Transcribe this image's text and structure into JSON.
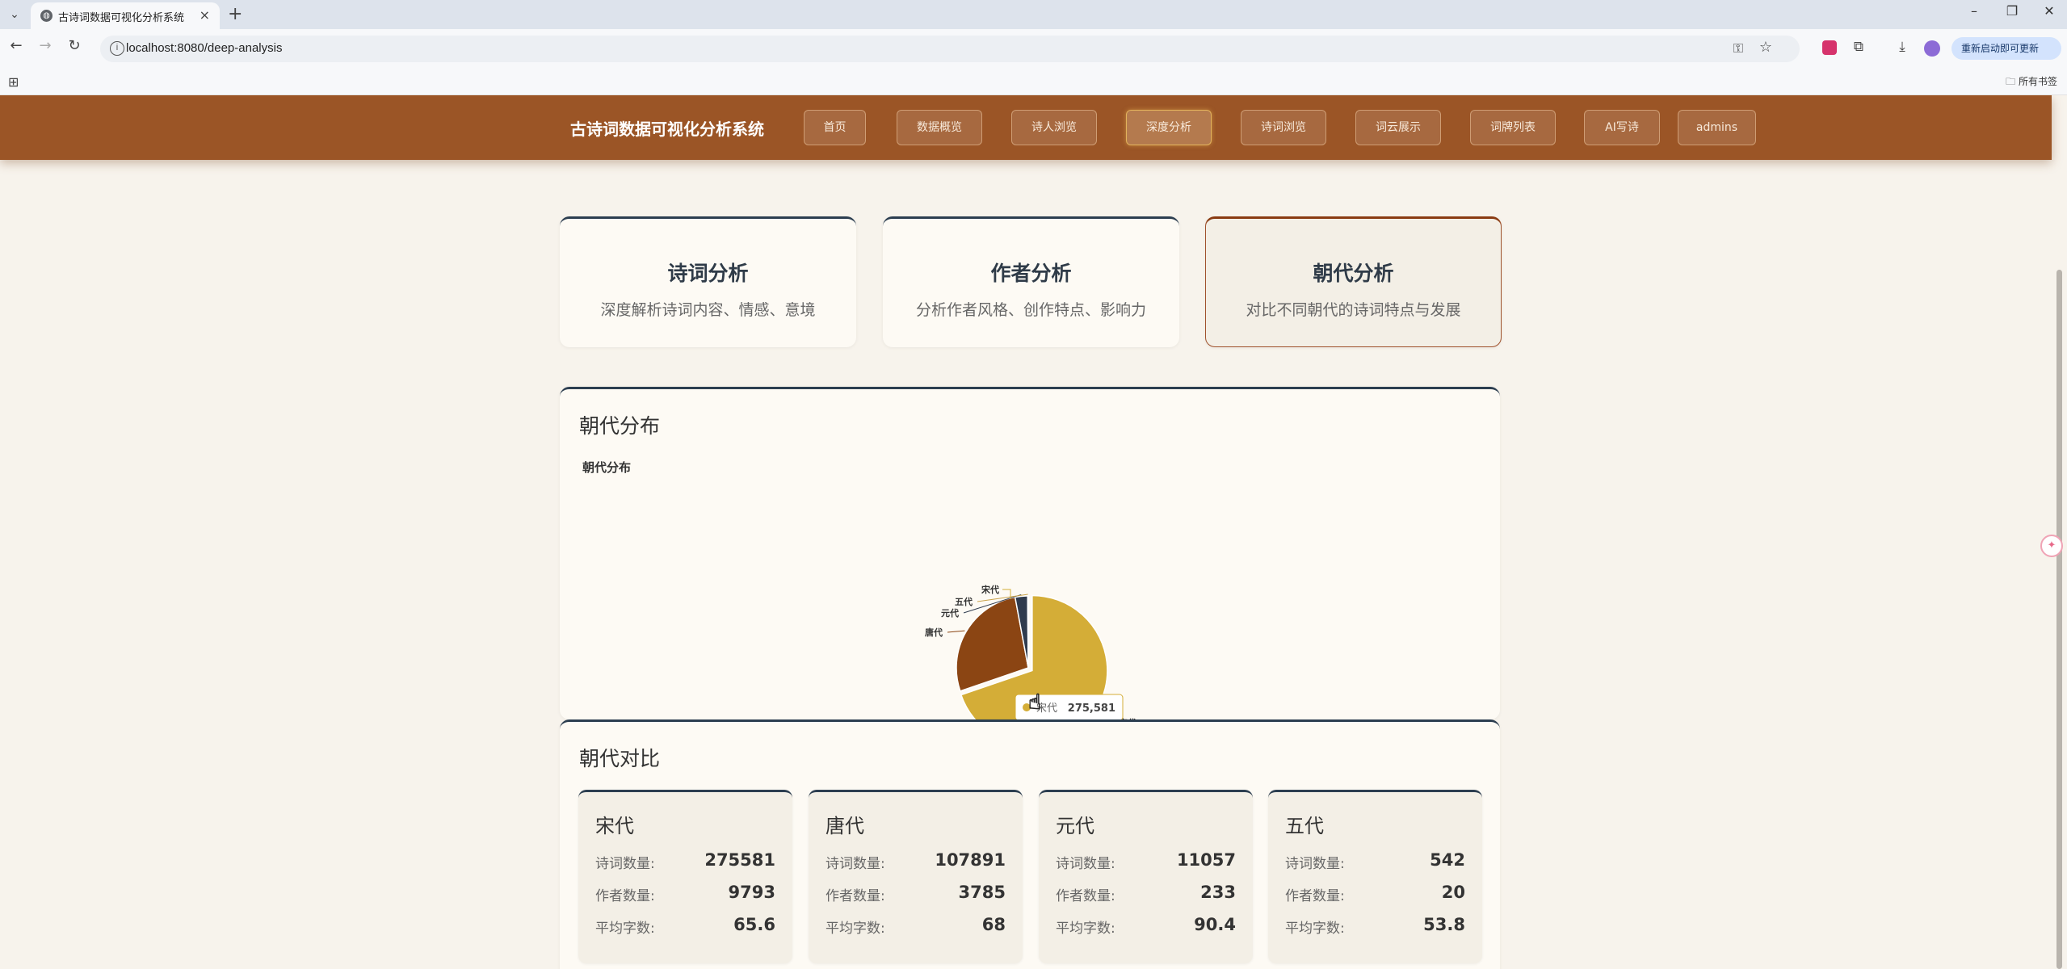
{
  "browser": {
    "tab_title": "古诗词数据可视化分析系统",
    "url": "localhost:8080/deep-analysis",
    "update_button": "重新启动即可更新",
    "bookmarks_label": "所有书签"
  },
  "header": {
    "title": "古诗词数据可视化分析系统",
    "nav": [
      "首页",
      "数据概览",
      "诗人浏览",
      "深度分析",
      "诗词浏览",
      "词云展示",
      "词牌列表",
      "AI写诗",
      "admins"
    ],
    "active_nav": "深度分析"
  },
  "features": [
    {
      "title": "诗词分析",
      "desc": "深度解析诗词内容、情感、意境"
    },
    {
      "title": "作者分析",
      "desc": "分析作者风格、创作特点、影响力"
    },
    {
      "title": "朝代分析",
      "desc": "对比不同朝代的诗词特点与发展",
      "active": true
    }
  ],
  "distribution": {
    "section_title": "朝代分布",
    "tooltip": {
      "name": "宋代",
      "value": "275,581"
    }
  },
  "chart_data": {
    "type": "pie",
    "title": "朝代分布",
    "categories": [
      "宋代",
      "唐代",
      "元代",
      "五代"
    ],
    "values": [
      275581,
      107891,
      11057,
      542
    ],
    "colors": [
      "#d4ad37",
      "#8b4513",
      "#2f3b4e",
      "#c9a24a"
    ]
  },
  "comparison": {
    "section_title": "朝代对比",
    "labels": {
      "poems": "诗词数量:",
      "authors": "作者数量:",
      "avg_chars": "平均字数:"
    },
    "dynasties": [
      {
        "name": "宋代",
        "poems": "275581",
        "authors": "9793",
        "avg_chars": "65.6"
      },
      {
        "name": "唐代",
        "poems": "107891",
        "authors": "3785",
        "avg_chars": "68"
      },
      {
        "name": "元代",
        "poems": "11057",
        "authors": "233",
        "avg_chars": "90.4"
      },
      {
        "name": "五代",
        "poems": "542",
        "authors": "20",
        "avg_chars": "53.8"
      }
    ]
  }
}
